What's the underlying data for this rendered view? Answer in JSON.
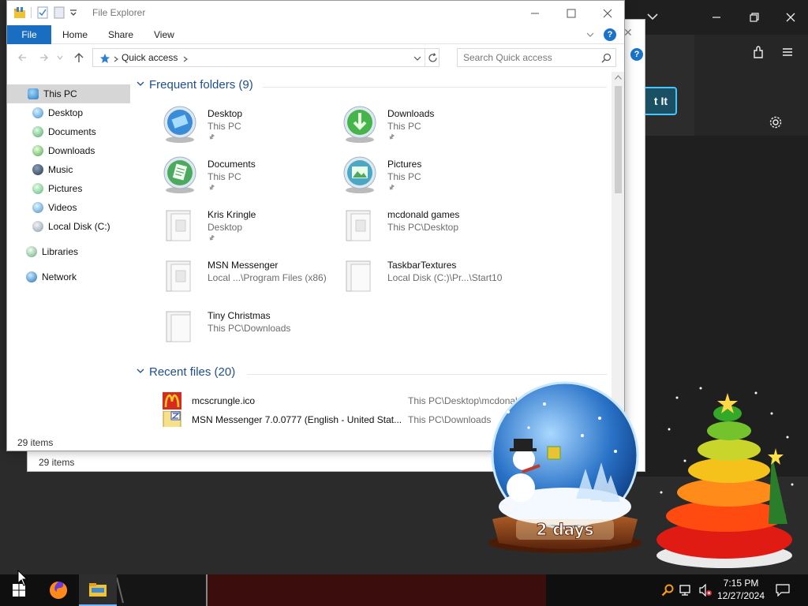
{
  "explorer": {
    "title": "File Explorer",
    "ribbon": {
      "file": "File",
      "home": "Home",
      "share": "Share",
      "view": "View"
    },
    "address": {
      "location": "Quick access"
    },
    "search": {
      "placeholder": "Search Quick access"
    },
    "nav": {
      "this_pc": "This PC",
      "desktop": "Desktop",
      "documents": "Documents",
      "downloads": "Downloads",
      "music": "Music",
      "pictures": "Pictures",
      "videos": "Videos",
      "local_disk": "Local Disk (C:)",
      "libraries": "Libraries",
      "network": "Network"
    },
    "frequent": {
      "header": "Frequent folders (9)",
      "items": [
        {
          "name": "Desktop",
          "location": "This PC",
          "pinned": true
        },
        {
          "name": "Downloads",
          "location": "This PC",
          "pinned": true
        },
        {
          "name": "Documents",
          "location": "This PC",
          "pinned": true
        },
        {
          "name": "Pictures",
          "location": "This PC",
          "pinned": true
        },
        {
          "name": "Kris Kringle",
          "location": "Desktop",
          "pinned": true
        },
        {
          "name": "mcdonald games",
          "location": "This PC\\Desktop",
          "pinned": false
        },
        {
          "name": "MSN Messenger",
          "location": "Local ...\\Program Files (x86)",
          "pinned": false
        },
        {
          "name": "TaskbarTextures",
          "location": "Local Disk (C:)\\Pr...\\Start10",
          "pinned": false
        },
        {
          "name": "Tiny Christmas",
          "location": "This PC\\Downloads",
          "pinned": false
        }
      ]
    },
    "recent": {
      "header": "Recent files (20)",
      "items": [
        {
          "name": "mcscrungle.ico",
          "path": "This PC\\Desktop\\mcdonald"
        },
        {
          "name": "MSN Messenger 7.0.0777 (English - United Stat...",
          "path": "This PC\\Downloads"
        }
      ]
    },
    "status": "29 items"
  },
  "explorer_back": {
    "status": "29 items"
  },
  "background_app": {
    "button_text": "t It"
  },
  "globe": {
    "countdown": "2 days"
  },
  "taskbar": {
    "time": "7:15 PM",
    "date": "12/27/2024",
    "apps": [
      "start",
      "firefox",
      "file-explorer"
    ]
  },
  "colors": {
    "accent": "#1a6ec2",
    "section_blue": "#1e4e8f",
    "taskbar": "#0f0f0f"
  }
}
